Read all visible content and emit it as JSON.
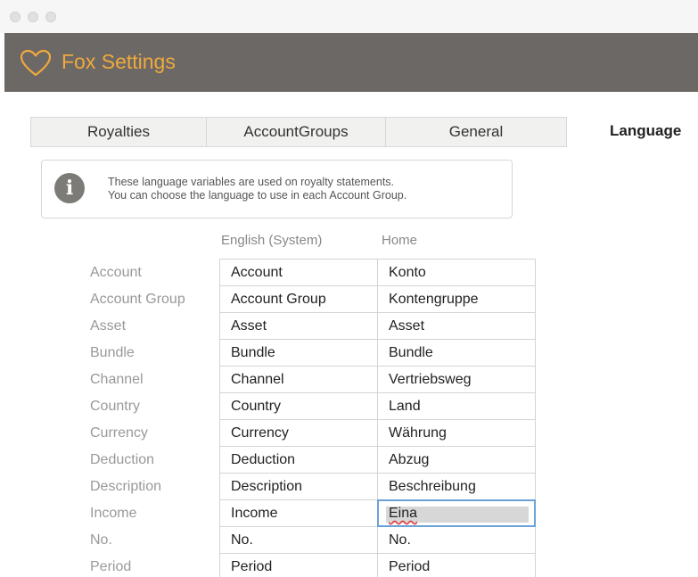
{
  "app": {
    "title": "Fox Settings",
    "logo_icon": "heart-outline-icon",
    "accent_color": "#f0a93d",
    "header_color": "#6c6865"
  },
  "tabs": [
    {
      "label": "Royalties",
      "active": false
    },
    {
      "label": "AccountGroups",
      "active": false
    },
    {
      "label": "General",
      "active": false
    },
    {
      "label": "Language",
      "active": true
    }
  ],
  "info": {
    "icon": "info-icon",
    "line1": "These language variables are used on royalty statements.",
    "line2": "You can choose the language to use in each Account Group."
  },
  "columns": {
    "english": "English (System)",
    "home": "Home"
  },
  "rows": [
    {
      "label": "Account",
      "english": "Account",
      "home": "Konto"
    },
    {
      "label": "Account Group",
      "english": "Account Group",
      "home": "Kontengruppe"
    },
    {
      "label": "Asset",
      "english": "Asset",
      "home": "Asset"
    },
    {
      "label": "Bundle",
      "english": "Bundle",
      "home": "Bundle"
    },
    {
      "label": "Channel",
      "english": "Channel",
      "home": "Vertriebsweg"
    },
    {
      "label": "Country",
      "english": "Country",
      "home": "Land"
    },
    {
      "label": "Currency",
      "english": "Currency",
      "home": "Währung"
    },
    {
      "label": "Deduction",
      "english": "Deduction",
      "home": "Abzug"
    },
    {
      "label": "Description",
      "english": "Description",
      "home": "Beschreibung"
    },
    {
      "label": "Income",
      "english": "Income",
      "home": "Eina",
      "focused": true
    },
    {
      "label": "No.",
      "english": "No.",
      "home": "No."
    },
    {
      "label": "Period",
      "english": "Period",
      "home": "Period"
    }
  ]
}
